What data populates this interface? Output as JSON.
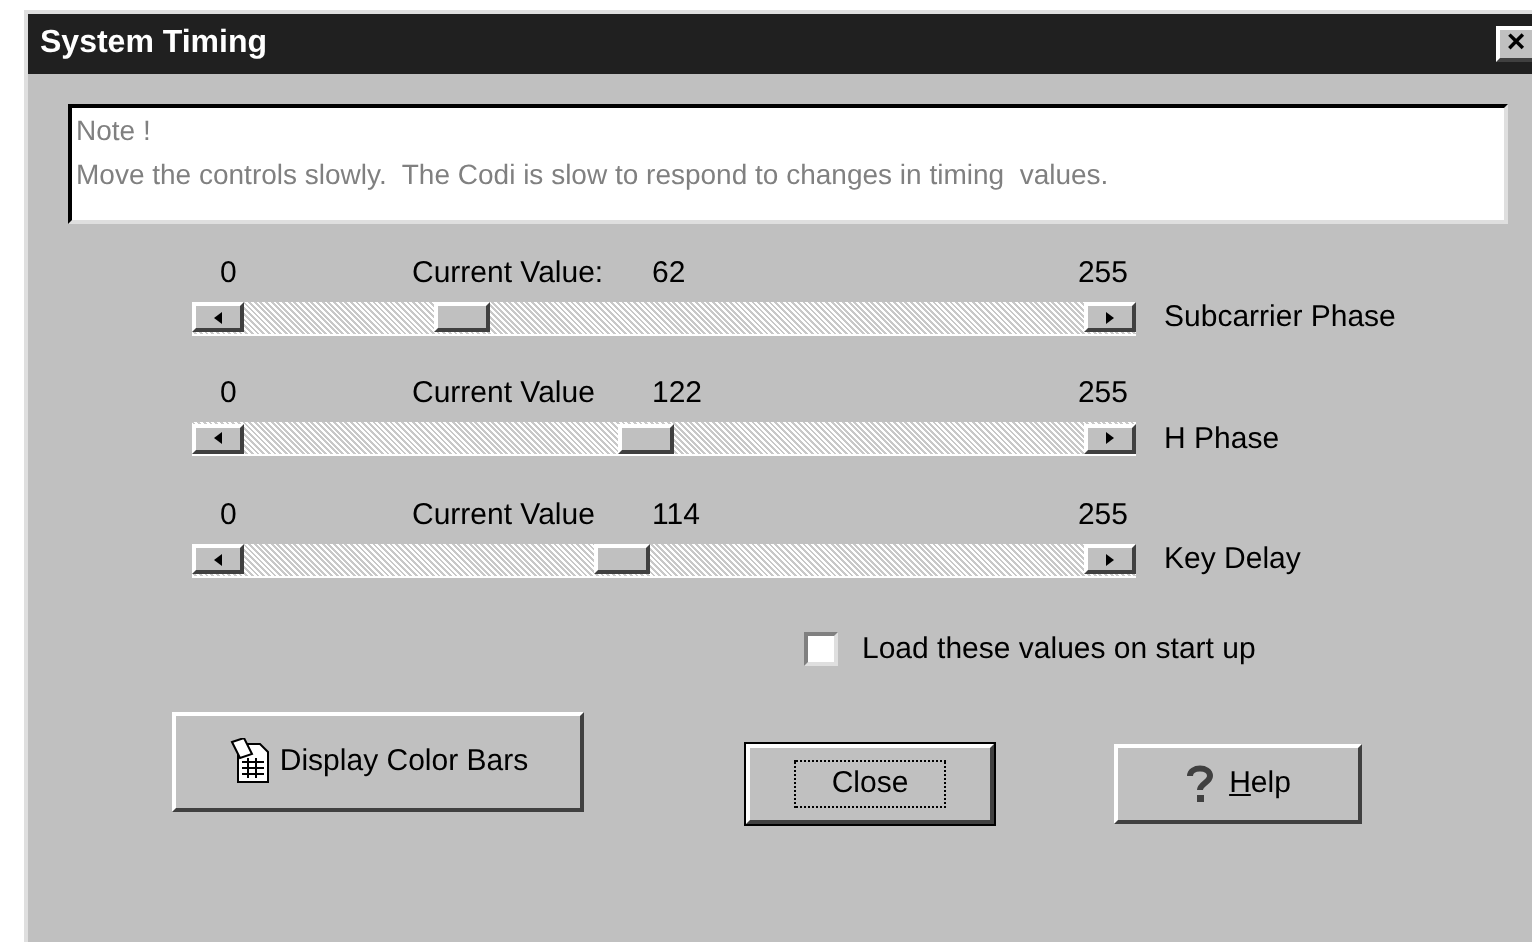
{
  "window": {
    "title": "System Timing",
    "close": "×"
  },
  "note": [
    "Note !",
    "Move the controls slowly.  The Codi is slow to respond to changes in timing  values."
  ],
  "sliders": [
    {
      "min": "0",
      "caption": "Current Value:",
      "value": "62",
      "max": "255",
      "name": "Subcarrier Phase",
      "level": 0.243
    },
    {
      "min": "0",
      "caption": "Current Value",
      "value": "122",
      "max": "255",
      "name": "H Phase",
      "level": 0.478
    },
    {
      "min": "0",
      "caption": "Current Value",
      "value": "114",
      "max": "255",
      "name": "Key Delay",
      "level": 0.447
    }
  ],
  "checkbox": {
    "label": "Load these values on start up",
    "checked": false
  },
  "buttons": [
    {
      "kind": "colorbars",
      "label": "Display Color Bars"
    },
    {
      "kind": "close",
      "label": "Close",
      "selected": true
    },
    {
      "kind": "help",
      "label": "Help"
    }
  ]
}
